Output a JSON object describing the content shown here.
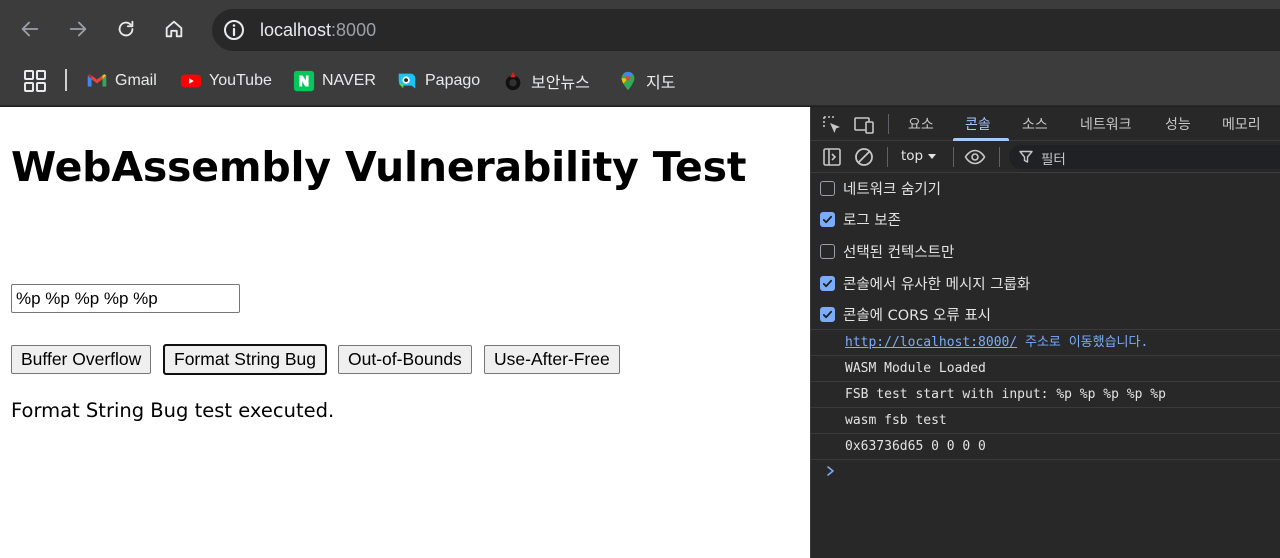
{
  "browser": {
    "url_host": "localhost",
    "url_port": ":8000"
  },
  "bookmarks": [
    {
      "label": "Gmail",
      "icon": "gmail-icon"
    },
    {
      "label": "YouTube",
      "icon": "youtube-icon"
    },
    {
      "label": "NAVER",
      "icon": "naver-icon"
    },
    {
      "label": "Papago",
      "icon": "papago-icon"
    },
    {
      "label": "보안뉴스",
      "icon": "boannews-icon"
    },
    {
      "label": "지도",
      "icon": "maps-icon"
    }
  ],
  "page": {
    "title": "WebAssembly Vulnerability Test",
    "input_value": "%p %p %p %p %p",
    "buttons": [
      "Buffer Overflow",
      "Format String Bug",
      "Out-of-Bounds",
      "Use-After-Free"
    ],
    "result_text": "Format String Bug test executed."
  },
  "devtools": {
    "tabs": [
      "요소",
      "콘솔",
      "소스",
      "네트워크",
      "성능",
      "메모리"
    ],
    "active_tab": "콘솔",
    "context": "top",
    "filter_placeholder": "필터",
    "settings": [
      {
        "label": "네트워크 숨기기",
        "checked": false
      },
      {
        "label": "로그 보존",
        "checked": true
      },
      {
        "label": "선택된 컨텍스트만",
        "checked": false
      },
      {
        "label": "콘솔에서 유사한 메시지 그룹화",
        "checked": true
      },
      {
        "label": "콘솔에 CORS 오류 표시",
        "checked": true
      }
    ],
    "messages": {
      "nav_link": "http://localhost:8000/",
      "nav_suffix": " 주소로 이동했습니다.",
      "lines": [
        "WASM Module Loaded",
        "FSB test start with input: %p %p %p %p %p",
        "wasm fsb test",
        "0x63736d65 0 0 0 0"
      ]
    }
  },
  "colors": {
    "chrome_bg": "#3c3c3c",
    "devtools_bg": "#282828",
    "accent": "#a8c7fa",
    "checkbox": "#7cacf8"
  }
}
